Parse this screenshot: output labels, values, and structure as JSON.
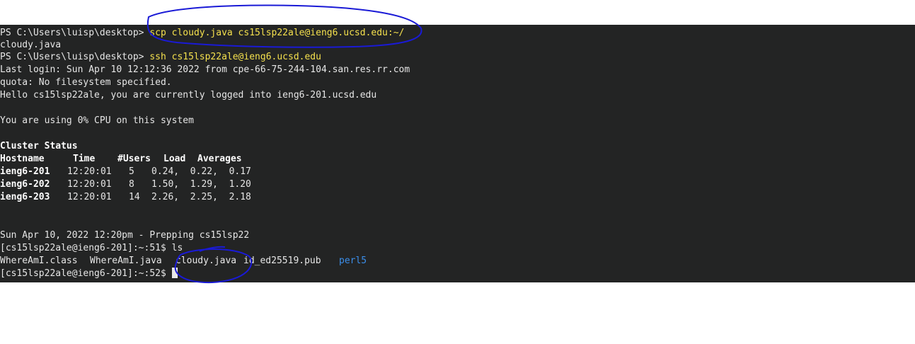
{
  "terminal": {
    "scp_prompt": "PS C:\\Users\\luisp\\desktop> ",
    "scp_cmd": "scp cloudy.java cs15lsp22ale@ieng6.ucsd.edu:~/",
    "scp_out": "cloudy.java",
    "ssh_prompt": "PS C:\\Users\\luisp\\desktop> ",
    "ssh_cmd": "ssh cs15lsp22ale@ieng6.ucsd.edu",
    "last_login": "Last login: Sun Apr 10 12:12:36 2022 from cpe-66-75-244-104.san.res.rr.com",
    "quota": "quota: No filesystem specified.",
    "hello": "Hello cs15lsp22ale, you are currently logged into ieng6-201.ucsd.edu",
    "cpu": "You are using 0% CPU on this system",
    "cluster_title": "Cluster Status",
    "cluster_headers": [
      "Hostname",
      "Time",
      "#Users",
      "Load",
      "Averages"
    ],
    "cluster_rows": [
      {
        "host": "ieng6-201",
        "time": "12:20:01",
        "users": "5",
        "load": "0.24,  0.22,  0.17"
      },
      {
        "host": "ieng6-202",
        "time": "12:20:01",
        "users": "8",
        "load": "1.50,  1.29,  1.20"
      },
      {
        "host": "ieng6-203",
        "time": "12:20:01",
        "users": "14",
        "load": "2.26,  2.25,  2.18"
      }
    ],
    "prep": "Sun Apr 10, 2022 12:20pm - Prepping cs15lsp22",
    "ls_prompt": "[cs15lsp22ale@ieng6-201]:~:51$ ",
    "ls_cmd": "ls",
    "ls_files": [
      "WhereAmI.class",
      "WhereAmI.java",
      "cloudy.java",
      "id_ed25519.pub"
    ],
    "ls_dir": "perl5",
    "final_prompt": "[cs15lsp22ale@ieng6-201]:~:52$ "
  },
  "colors": {
    "background": "#232424",
    "text": "#e6e6e6",
    "command": "#f4e04d",
    "directory": "#3b8eea",
    "annotation": "#1a1ad6"
  }
}
